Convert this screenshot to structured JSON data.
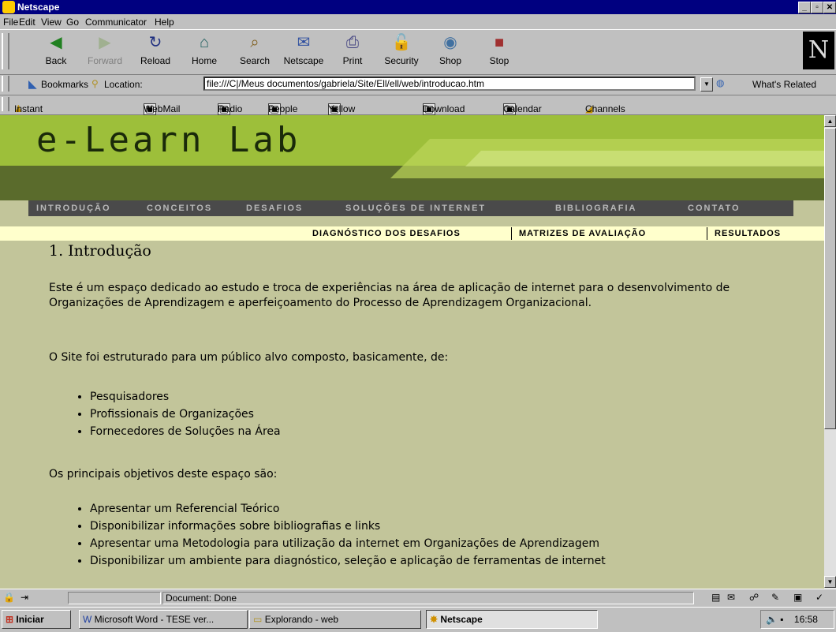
{
  "window": {
    "title": "Netscape"
  },
  "menu": [
    "File",
    "Edit",
    "View",
    "Go",
    "Communicator",
    "Help"
  ],
  "toolbar": [
    {
      "label": "Back",
      "icon": "back-icon",
      "glyph": "◀",
      "color": "#208020"
    },
    {
      "label": "Forward",
      "icon": "forward-icon",
      "glyph": "▶",
      "color": "#a0b090"
    },
    {
      "label": "Reload",
      "icon": "reload-icon",
      "glyph": "↻",
      "color": "#203080"
    },
    {
      "label": "Home",
      "icon": "home-icon",
      "glyph": "⌂",
      "color": "#206060"
    },
    {
      "label": "Search",
      "icon": "search-icon",
      "glyph": "⌕",
      "color": "#806020"
    },
    {
      "label": "Netscape",
      "icon": "netscape-icon",
      "glyph": "✉",
      "color": "#3050a0"
    },
    {
      "label": "Print",
      "icon": "print-icon",
      "glyph": "⎙",
      "color": "#404080"
    },
    {
      "label": "Security",
      "icon": "security-icon",
      "glyph": "🔓",
      "color": "#606060"
    },
    {
      "label": "Shop",
      "icon": "shop-icon",
      "glyph": "◉",
      "color": "#4070a0"
    },
    {
      "label": "Stop",
      "icon": "stop-icon",
      "glyph": "■",
      "color": "#a03030"
    }
  ],
  "location": {
    "bookmarks_label": "Bookmarks",
    "location_label": "Location:",
    "url": "file:///C|/Meus documentos/gabriela/Site/Ell/ell/web/introducao.htm",
    "whats_related": "What's Related"
  },
  "personal_toolbar": [
    "Instant Message",
    "WebMail",
    "Radio",
    "People",
    "Yellow Pages",
    "Download",
    "Calendar",
    "Channels"
  ],
  "page": {
    "banner_title": "e-Learn Lab",
    "nav": [
      "INTRODUÇÃO",
      "CONCEITOS",
      "DESAFIOS",
      "SOLUÇÕES DE INTERNET",
      "BIBLIOGRAFIA",
      "CONTATO"
    ],
    "subnav": [
      "DIAGNÓSTICO DOS DESAFIOS",
      "MATRIZES DE AVALIAÇÃO",
      "RESULTADOS"
    ],
    "title": "1. Introdução",
    "para1": "Este é um espaço dedicado ao estudo e troca de experiências na área de aplicação de internet para o desenvolvimento de Organizações de Aprendizagem e aperfeiçoamento do Processo de Aprendizagem Organizacional.",
    "para2": "O Site foi estruturado para um público alvo composto, basicamente, de:",
    "list1": [
      "Pesquisadores",
      "Profissionais de Organizações",
      "Fornecedores de Soluções na Área"
    ],
    "para3": "Os principais objetivos deste espaço são:",
    "list2": [
      "Apresentar um Referencial Teórico",
      "Disponibilizar informações sobre bibliografias e links",
      "Apresentar uma Metodologia para utilização da internet em Organizações de Aprendizagem",
      "Disponibilizar um ambiente para diagnóstico, seleção e aplicação de ferramentas de internet"
    ]
  },
  "status": {
    "text": "Document: Done"
  },
  "taskbar": {
    "start": "Iniciar",
    "tasks": [
      "Microsoft Word - TESE ver...",
      "Explorando - web",
      "Netscape"
    ],
    "clock": "16:58"
  }
}
